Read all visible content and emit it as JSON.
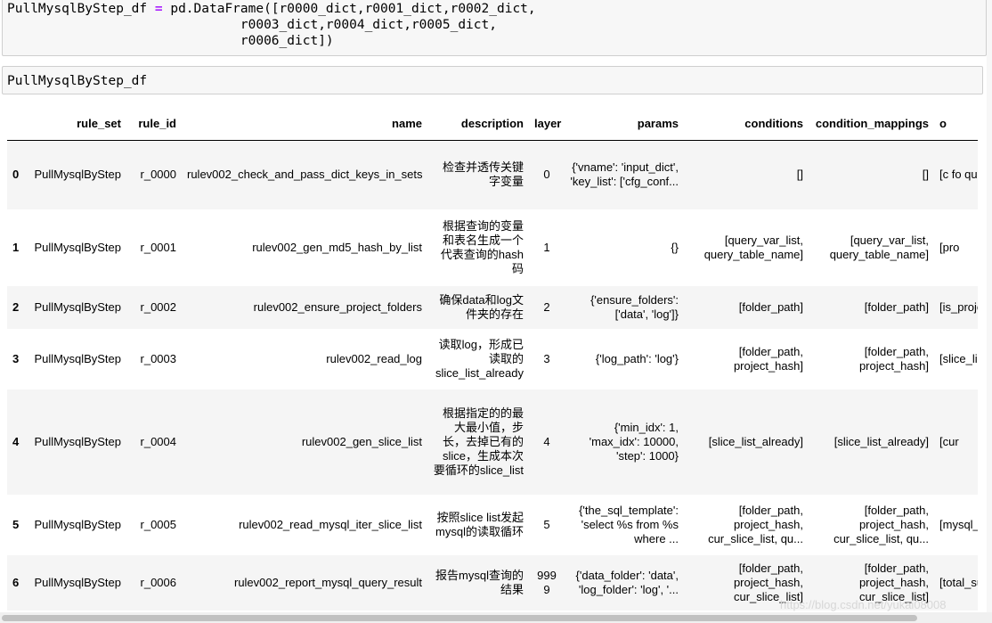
{
  "cell1": {
    "lines": [
      [
        "PullMysqlByStep_df ",
        "=",
        " pd.DataFrame([r0000_dict,r0001_dict,r0002_dict,"
      ],
      [
        "",
        "",
        "                              r0003_dict,r0004_dict,r0005_dict,"
      ],
      [
        "",
        "",
        "                              r0006_dict])"
      ]
    ]
  },
  "cell2": {
    "code": "PullMysqlByStep_df"
  },
  "table": {
    "columns": [
      "",
      "rule_set",
      "rule_id",
      "name",
      "description",
      "layer",
      "params",
      "conditions",
      "condition_mappings",
      "o"
    ],
    "rows": [
      {
        "index": "0",
        "rule_set": "PullMysqlByStep",
        "rule_id": "r_0000",
        "name": "rulev002_check_and_pass_dict_keys_in_sets",
        "description": "检查并透传关键字变量",
        "layer": "0",
        "params": "{'vname': 'input_dict', 'key_list': ['cfg_conf...",
        "conditions": "[]",
        "condition_mappings": "[]",
        "o": "[c fo que"
      },
      {
        "index": "1",
        "rule_set": "PullMysqlByStep",
        "rule_id": "r_0001",
        "name": "rulev002_gen_md5_hash_by_list",
        "description": "根据查询的变量和表名生成一个代表查询的hash码",
        "layer": "1",
        "params": "{}",
        "conditions": "[query_var_list, query_table_name]",
        "condition_mappings": "[query_var_list, query_table_name]",
        "o": "[pro"
      },
      {
        "index": "2",
        "rule_set": "PullMysqlByStep",
        "rule_id": "r_0002",
        "name": "rulev002_ensure_project_folders",
        "description": "确保data和log文件夹的存在",
        "layer": "2",
        "params": "{'ensure_folders': ['data', 'log']}",
        "conditions": "[folder_path]",
        "condition_mappings": "[folder_path]",
        "o": "[is_project_"
      },
      {
        "index": "3",
        "rule_set": "PullMysqlByStep",
        "rule_id": "r_0003",
        "name": "rulev002_read_log",
        "description": "读取log，形成已读取的slice_list_already",
        "layer": "3",
        "params": "{'log_path': 'log'}",
        "conditions": "[folder_path, project_hash]",
        "condition_mappings": "[folder_path, project_hash]",
        "o": "[slice_lis"
      },
      {
        "index": "4",
        "rule_set": "PullMysqlByStep",
        "rule_id": "r_0004",
        "name": "rulev002_gen_slice_list",
        "description": "根据指定的的最大最小值，步长，去掉已有的slice，生成本次要循环的slice_list",
        "layer": "4",
        "params": "{'min_idx': 1, 'max_idx': 10000, 'step': 1000}",
        "conditions": "[slice_list_already]",
        "condition_mappings": "[slice_list_already]",
        "o": "[cur"
      },
      {
        "index": "5",
        "rule_set": "PullMysqlByStep",
        "rule_id": "r_0005",
        "name": "rulev002_read_mysql_iter_slice_list",
        "description": "按照slice list发起mysql的读取循环",
        "layer": "5",
        "params": "{'the_sql_template': 'select %s from %s where ...",
        "conditions": "[folder_path, project_hash, cur_slice_list, qu...",
        "condition_mappings": "[folder_path, project_hash, cur_slice_list, qu...",
        "o": "[mysql_re"
      },
      {
        "index": "6",
        "rule_set": "PullMysqlByStep",
        "rule_id": "r_0006",
        "name": "rulev002_report_mysql_query_result",
        "description": "报告mysql查询的结果",
        "layer": "9999",
        "params": "{'data_folder': 'data', 'log_folder': 'log', '...",
        "conditions": "[folder_path, project_hash, cur_slice_list]",
        "condition_mappings": "[folder_path, project_hash, cur_slice_list]",
        "o": "[total_suc cur_suc"
      }
    ]
  },
  "watermark": "https://blog.csdn.net/yukai08008"
}
